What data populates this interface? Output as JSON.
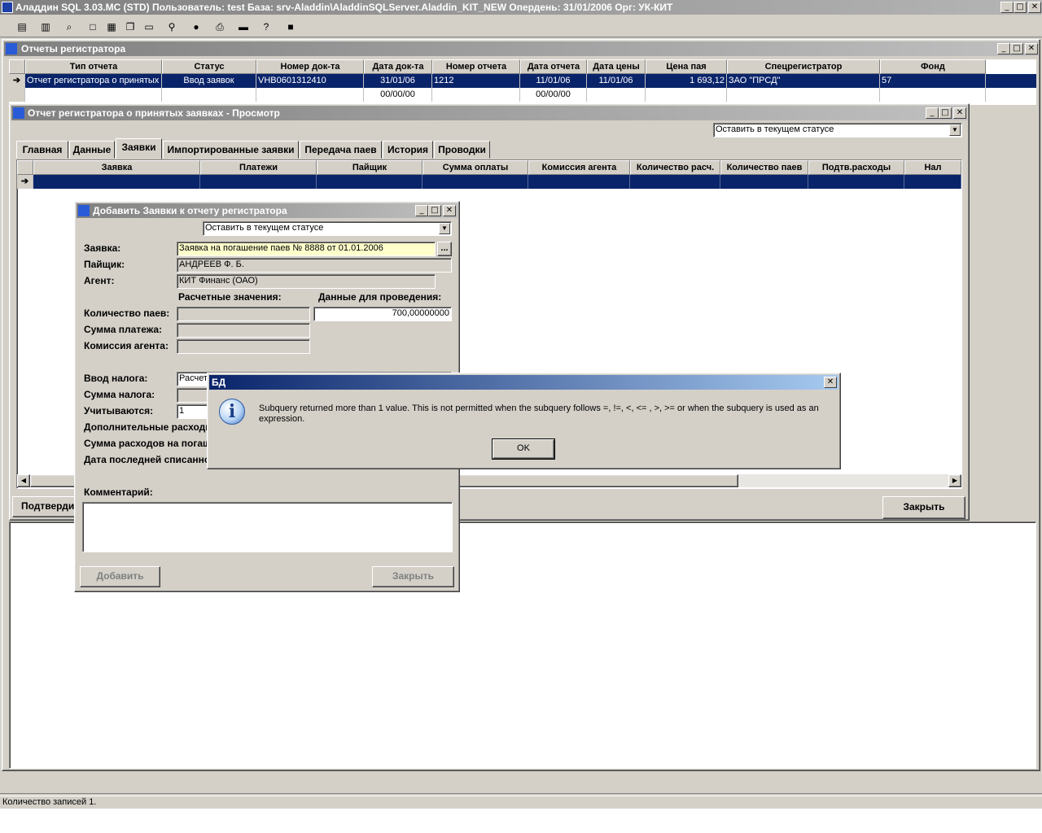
{
  "app": {
    "title": "Аладдин SQL 3.03.МС (STD)  Пользователь: test База: srv-Aladdin\\AladdinSQLServer.Aladdin_KIT_NEW Опердень: 31/01/2006 Орг: УК-КИТ",
    "window_controls": {
      "min": "_",
      "max": "□",
      "close": "✕"
    }
  },
  "toolbar": {
    "buttons": [
      {
        "name": "journal",
        "glyph": "▤"
      },
      {
        "name": "database",
        "glyph": "▥"
      },
      {
        "name": "find",
        "glyph": "⌕"
      },
      {
        "name": "window",
        "glyph": "□"
      },
      {
        "name": "tile",
        "glyph": "▦"
      },
      {
        "name": "cascade",
        "glyph": "❐"
      },
      {
        "name": "preview",
        "glyph": "▭"
      },
      {
        "name": "search",
        "glyph": "⚲"
      },
      {
        "name": "stop",
        "glyph": "●"
      },
      {
        "name": "print",
        "glyph": "⎙"
      },
      {
        "name": "export",
        "glyph": "▬"
      },
      {
        "name": "help",
        "glyph": "?"
      },
      {
        "name": "exit",
        "glyph": "■"
      }
    ]
  },
  "reports_window": {
    "title": "Отчеты регистратора",
    "columns": [
      "Тип отчета",
      "Статус",
      "Номер док-та",
      "Дата док-та",
      "Номер отчета",
      "Дата отчета",
      "Дата цены",
      "Цена пая",
      "Спецрегистратор",
      "Фонд"
    ],
    "rows": [
      [
        "Отчет регистратора о принятых з",
        "Ввод заявок",
        "VНВ0601312410",
        "31/01/06",
        "1212",
        "11/01/06",
        "11/01/06",
        "1 693,12",
        "ЗАО \"ПРСД\"",
        "57"
      ],
      [
        "",
        "",
        "",
        "00/00/00",
        "",
        "00/00/00",
        "",
        "",
        "",
        ""
      ]
    ]
  },
  "report_view": {
    "title": "Отчет регистратора о принятых заявках - Просмотр",
    "status_combo": "Оставить в текущем статусе",
    "tabs": [
      "Главная",
      "Данные",
      "Заявки",
      "Импортированные заявки",
      "Передача паев",
      "История",
      "Проводки"
    ],
    "active_tab": "Заявки",
    "columns": [
      "Заявка",
      "Платежи",
      "Пайщик",
      "Сумма оплаты",
      "Комиссия агента",
      "Количество расч.",
      "Количество паев",
      "Подтв.расходы",
      "Нал"
    ],
    "confirm_button": "Подтверди",
    "close_button": "Закрыть"
  },
  "add_dialog": {
    "title": "Добавить Заявки к отчету регистратора",
    "status_combo": "Оставить в текущем статусе",
    "labels": {
      "request": "Заявка:",
      "holder": "Пайщик:",
      "agent": "Агент:",
      "calc_values": "Расчетные значения:",
      "posting_data": "Данные для проведения:",
      "qty": "Количество паев:",
      "payment": "Сумма платежа:",
      "commission": "Комиссия агента:",
      "tax_input": "Ввод налога:",
      "tax_sum": "Сумма налога:",
      "counted": "Учитываются:",
      "extra_expenses": "Дополнительные расходы",
      "redeem_expenses": "Сумма расходов на погаш",
      "last_writeoff": "Дата последней списанно",
      "comment": "Комментарий:"
    },
    "values": {
      "request": "Заявка на погашение паев № 8888 от 01.01.2006",
      "browse": "...",
      "holder": "АНДРЕЕВ Ф. Б.",
      "agent": "КИТ Финанс (ОАО)",
      "qty_posting": "700,00000000",
      "tax_input": "Расчет",
      "counted": "1"
    },
    "add_button": "Добавить",
    "close_button": "Закрыть"
  },
  "error_dialog": {
    "title": "БД",
    "message": "Subquery returned more than 1 value. This is not permitted when the subquery follows =, !=, <, <= , >, >= or when the subquery is used as an expression.",
    "ok": "OK"
  },
  "statusbar": {
    "records": "Количество записей 1."
  }
}
